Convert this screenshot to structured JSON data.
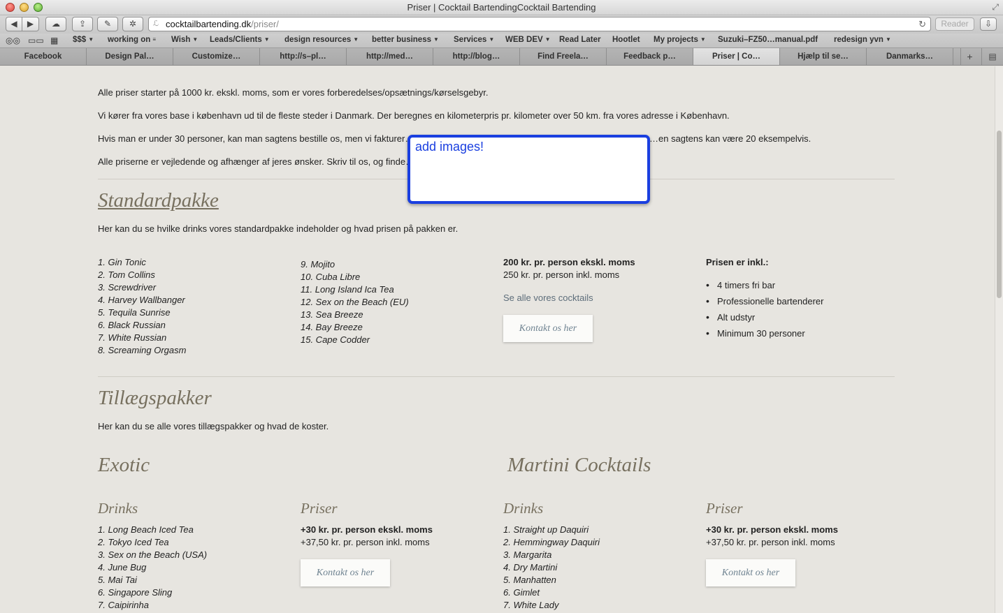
{
  "window": {
    "title": "Priser | Cocktail BartendingCocktail Bartending"
  },
  "toolbar": {
    "url_host": "cocktailbartending.dk",
    "url_path": "/priser/",
    "reader_label": "Reader"
  },
  "bookmarks": [
    {
      "label": "$$$",
      "menu": true
    },
    {
      "label": "working on",
      "menu": true
    },
    {
      "label": "Wish",
      "menu": true
    },
    {
      "label": "Leads/Clients",
      "menu": true
    },
    {
      "label": "design resources",
      "menu": true
    },
    {
      "label": "better business",
      "menu": true
    },
    {
      "label": "Services",
      "menu": true
    },
    {
      "label": "WEB DEV",
      "menu": true
    },
    {
      "label": "Read Later",
      "menu": false
    },
    {
      "label": "Hootlet",
      "menu": false
    },
    {
      "label": "My projects",
      "menu": true
    },
    {
      "label": "Suzuki–FZ50…manual.pdf",
      "menu": false
    },
    {
      "label": "redesign yvn",
      "menu": true
    }
  ],
  "tabs": [
    {
      "label": "Facebook"
    },
    {
      "label": "Design Pal…"
    },
    {
      "label": "Customize…"
    },
    {
      "label": "http://s–pl…"
    },
    {
      "label": "http://med…"
    },
    {
      "label": "http://blog…"
    },
    {
      "label": "Find Freela…"
    },
    {
      "label": "Feedback p…"
    },
    {
      "label": "Priser | Co…"
    },
    {
      "label": "Hjælp til se…"
    },
    {
      "label": "Danmarks…"
    }
  ],
  "content": {
    "intro": [
      "Alle priser starter på 1000 kr. ekskl. moms, som er vores forberedelses/opsætnings/kørselsgebyr.",
      "Vi kører fra vores base i københavn ud til de fleste steder i Danmark. Der beregnes en kilometerpris pr. kilometer over 50 km. fra vores adresse i København.",
      "Hvis man er under 30 personer, kan man sagtens bestille os, men vi fakturer…",
      "…en sagtens kan være 20 eksempelvis.",
      "Alle priserne er vejledende og afhænger af jeres ønsker. Skriv til os, og finde…"
    ],
    "note_text": "add images!",
    "standard": {
      "heading": "Standardpakke",
      "description": "Her kan du se hvilke drinks vores standardpakke indeholder og hvad prisen på pakken er.",
      "drinks_col1": [
        "1. Gin Tonic",
        "2. Tom Collins",
        "3. Screwdriver",
        "4. Harvey Wallbanger",
        "5. Tequila Sunrise",
        "6. Black Russian",
        "7. White Russian",
        "8. Screaming Orgasm"
      ],
      "drinks_col2": [
        "9. Mojito",
        "10. Cuba Libre",
        "11. Long Island Ica Tea",
        "12. Sex on the Beach (EU)",
        "13. Sea Breeze",
        "14. Bay Breeze",
        "15. Cape Codder"
      ],
      "price_excl": "200 kr. pr. person ekskl. moms",
      "price_incl": "250 kr. pr. person inkl. moms",
      "see_all_link": "Se alle vores cocktails",
      "contact_button": "Kontakt os her",
      "included_heading": "Prisen er inkl.:",
      "included_items": [
        "4 timers fri bar",
        "Professionelle bartenderer",
        "Alt udstyr",
        "Minimum 30 personer"
      ]
    },
    "addons": {
      "heading": "Tillægspakker",
      "description": "Her kan du se alle vores tillægspakker og hvad de koster.",
      "exotic": {
        "heading": "Exotic",
        "drinks_label": "Drinks",
        "prices_label": "Priser",
        "drinks": [
          "1. Long Beach Iced Tea",
          "2. Tokyo Iced Tea",
          "3. Sex on the Beach (USA)",
          "4. June Bug",
          "5. Mai Tai",
          "6. Singapore Sling",
          "7. Caipirinha"
        ],
        "price_excl": "+30 kr. pr. person ekskl. moms",
        "price_incl": "+37,50 kr. pr. person inkl. moms",
        "contact_button": "Kontakt os her"
      },
      "martini": {
        "heading": "Martini Cocktails",
        "drinks_label": "Drinks",
        "prices_label": "Priser",
        "drinks": [
          "1. Straight up Daquiri",
          "2. Hemmingway Daquiri",
          "3. Margarita",
          "4. Dry Martini",
          "5. Manhatten",
          "6. Gimlet",
          "7. White Lady"
        ],
        "price_excl": "+30 kr. pr. person ekskl. moms",
        "price_incl": "+37,50 kr. pr. person inkl. moms",
        "contact_button": "Kontakt os her"
      }
    }
  }
}
